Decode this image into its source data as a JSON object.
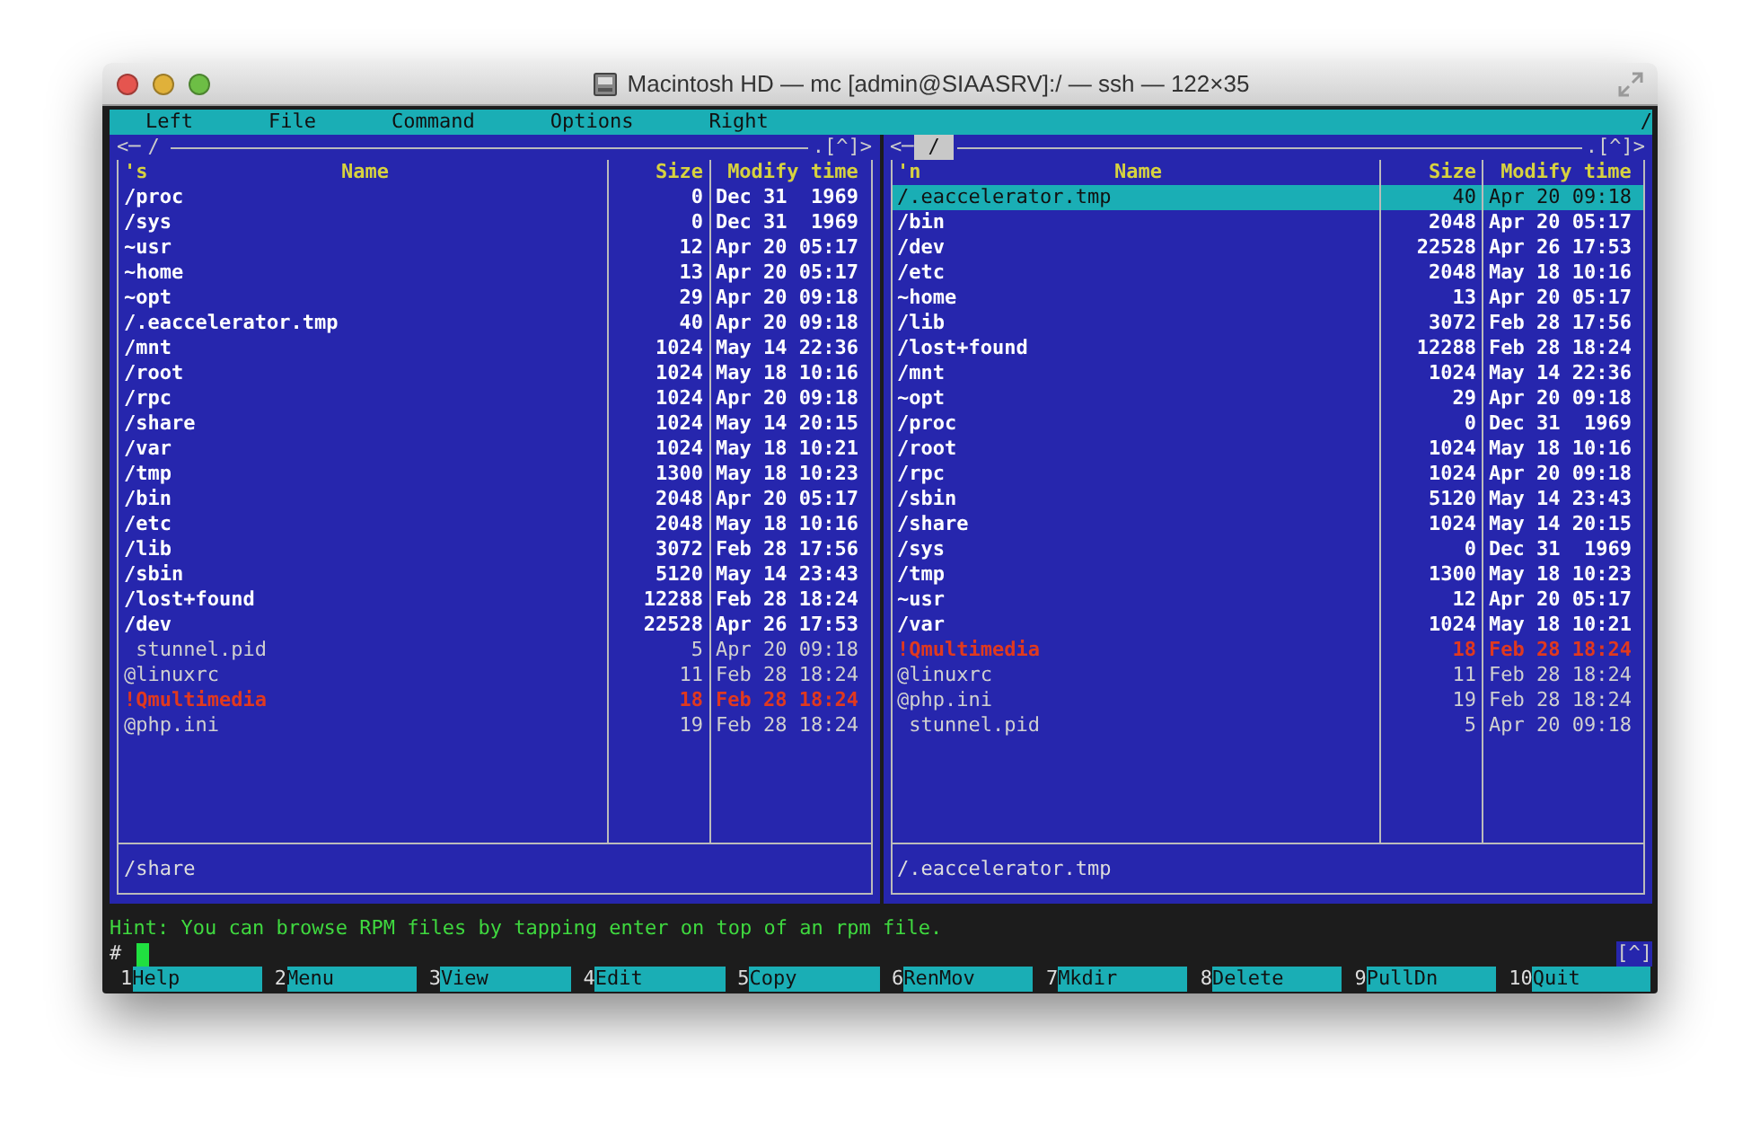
{
  "window": {
    "title": "Macintosh HD — mc [admin@SIAASRV]:/ — ssh — 122×35"
  },
  "menu": [
    "Left",
    "File",
    "Command",
    "Options",
    "Right"
  ],
  "menu_edge": "/",
  "panels": [
    {
      "active": false,
      "nav_left": "<─",
      "path": "/",
      "nav_right": ".[^]>",
      "sort": "'s",
      "columns": [
        "Name",
        "Size",
        "Modify time"
      ],
      "status": "/share",
      "rows": [
        {
          "name": "/proc",
          "size": "0",
          "time": "Dec 31  1969",
          "kind": "dir",
          "selected": false
        },
        {
          "name": "/sys",
          "size": "0",
          "time": "Dec 31  1969",
          "kind": "dir",
          "selected": false
        },
        {
          "name": "~usr",
          "size": "12",
          "time": "Apr 20 05:17",
          "kind": "dir",
          "selected": false
        },
        {
          "name": "~home",
          "size": "13",
          "time": "Apr 20 05:17",
          "kind": "dir",
          "selected": false
        },
        {
          "name": "~opt",
          "size": "29",
          "time": "Apr 20 09:18",
          "kind": "dir",
          "selected": false
        },
        {
          "name": "/.eaccelerator.tmp",
          "size": "40",
          "time": "Apr 20 09:18",
          "kind": "dir",
          "selected": false
        },
        {
          "name": "/mnt",
          "size": "1024",
          "time": "May 14 22:36",
          "kind": "dir",
          "selected": false
        },
        {
          "name": "/root",
          "size": "1024",
          "time": "May 18 10:16",
          "kind": "dir",
          "selected": false
        },
        {
          "name": "/rpc",
          "size": "1024",
          "time": "Apr 20 09:18",
          "kind": "dir",
          "selected": false
        },
        {
          "name": "/share",
          "size": "1024",
          "time": "May 14 20:15",
          "kind": "dir",
          "selected": false
        },
        {
          "name": "/var",
          "size": "1024",
          "time": "May 18 10:21",
          "kind": "dir",
          "selected": false
        },
        {
          "name": "/tmp",
          "size": "1300",
          "time": "May 18 10:23",
          "kind": "dir",
          "selected": false
        },
        {
          "name": "/bin",
          "size": "2048",
          "time": "Apr 20 05:17",
          "kind": "dir",
          "selected": false
        },
        {
          "name": "/etc",
          "size": "2048",
          "time": "May 18 10:16",
          "kind": "dir",
          "selected": false
        },
        {
          "name": "/lib",
          "size": "3072",
          "time": "Feb 28 17:56",
          "kind": "dir",
          "selected": false
        },
        {
          "name": "/sbin",
          "size": "5120",
          "time": "May 14 23:43",
          "kind": "dir",
          "selected": false
        },
        {
          "name": "/lost+found",
          "size": "12288",
          "time": "Feb 28 18:24",
          "kind": "dir",
          "selected": false
        },
        {
          "name": "/dev",
          "size": "22528",
          "time": "Apr 26 17:53",
          "kind": "dir",
          "selected": false
        },
        {
          "name": " stunnel.pid",
          "size": "5",
          "time": "Apr 20 09:18",
          "kind": "file",
          "selected": false
        },
        {
          "name": "@linuxrc",
          "size": "11",
          "time": "Feb 28 18:24",
          "kind": "file",
          "selected": false
        },
        {
          "name": "!Qmultimedia",
          "size": "18",
          "time": "Feb 28 18:24",
          "kind": "broken",
          "selected": false
        },
        {
          "name": "@php.ini",
          "size": "19",
          "time": "Feb 28 18:24",
          "kind": "file",
          "selected": false
        }
      ]
    },
    {
      "active": true,
      "nav_left": "<─",
      "path": "/",
      "nav_right": ".[^]>",
      "sort": "'n",
      "columns": [
        "Name",
        "Size",
        "Modify time"
      ],
      "status": "/.eaccelerator.tmp",
      "rows": [
        {
          "name": "/.eaccelerator.tmp",
          "size": "40",
          "time": "Apr 20 09:18",
          "kind": "dir",
          "selected": true
        },
        {
          "name": "/bin",
          "size": "2048",
          "time": "Apr 20 05:17",
          "kind": "dir",
          "selected": false
        },
        {
          "name": "/dev",
          "size": "22528",
          "time": "Apr 26 17:53",
          "kind": "dir",
          "selected": false
        },
        {
          "name": "/etc",
          "size": "2048",
          "time": "May 18 10:16",
          "kind": "dir",
          "selected": false
        },
        {
          "name": "~home",
          "size": "13",
          "time": "Apr 20 05:17",
          "kind": "dir",
          "selected": false
        },
        {
          "name": "/lib",
          "size": "3072",
          "time": "Feb 28 17:56",
          "kind": "dir",
          "selected": false
        },
        {
          "name": "/lost+found",
          "size": "12288",
          "time": "Feb 28 18:24",
          "kind": "dir",
          "selected": false
        },
        {
          "name": "/mnt",
          "size": "1024",
          "time": "May 14 22:36",
          "kind": "dir",
          "selected": false
        },
        {
          "name": "~opt",
          "size": "29",
          "time": "Apr 20 09:18",
          "kind": "dir",
          "selected": false
        },
        {
          "name": "/proc",
          "size": "0",
          "time": "Dec 31  1969",
          "kind": "dir",
          "selected": false
        },
        {
          "name": "/root",
          "size": "1024",
          "time": "May 18 10:16",
          "kind": "dir",
          "selected": false
        },
        {
          "name": "/rpc",
          "size": "1024",
          "time": "Apr 20 09:18",
          "kind": "dir",
          "selected": false
        },
        {
          "name": "/sbin",
          "size": "5120",
          "time": "May 14 23:43",
          "kind": "dir",
          "selected": false
        },
        {
          "name": "/share",
          "size": "1024",
          "time": "May 14 20:15",
          "kind": "dir",
          "selected": false
        },
        {
          "name": "/sys",
          "size": "0",
          "time": "Dec 31  1969",
          "kind": "dir",
          "selected": false
        },
        {
          "name": "/tmp",
          "size": "1300",
          "time": "May 18 10:23",
          "kind": "dir",
          "selected": false
        },
        {
          "name": "~usr",
          "size": "12",
          "time": "Apr 20 05:17",
          "kind": "dir",
          "selected": false
        },
        {
          "name": "/var",
          "size": "1024",
          "time": "May 18 10:21",
          "kind": "dir",
          "selected": false
        },
        {
          "name": "!Qmultimedia",
          "size": "18",
          "time": "Feb 28 18:24",
          "kind": "broken",
          "selected": false
        },
        {
          "name": "@linuxrc",
          "size": "11",
          "time": "Feb 28 18:24",
          "kind": "file",
          "selected": false
        },
        {
          "name": "@php.ini",
          "size": "19",
          "time": "Feb 28 18:24",
          "kind": "file",
          "selected": false
        },
        {
          "name": " stunnel.pid",
          "size": "5",
          "time": "Apr 20 09:18",
          "kind": "file",
          "selected": false
        }
      ]
    }
  ],
  "hint": "Hint: You can browse RPM files by tapping enter on top of an rpm file.",
  "prompt": "#",
  "prompt_badge": "[^]",
  "function_keys": [
    {
      "number": "1",
      "label": "Help"
    },
    {
      "number": "2",
      "label": "Menu"
    },
    {
      "number": "3",
      "label": "View"
    },
    {
      "number": "4",
      "label": "Edit"
    },
    {
      "number": "5",
      "label": "Copy"
    },
    {
      "number": "6",
      "label": "RenMov"
    },
    {
      "number": "7",
      "label": "Mkdir"
    },
    {
      "number": "8",
      "label": "Delete"
    },
    {
      "number": "9",
      "label": "PullDn"
    },
    {
      "number": "10",
      "label": "Quit"
    }
  ]
}
